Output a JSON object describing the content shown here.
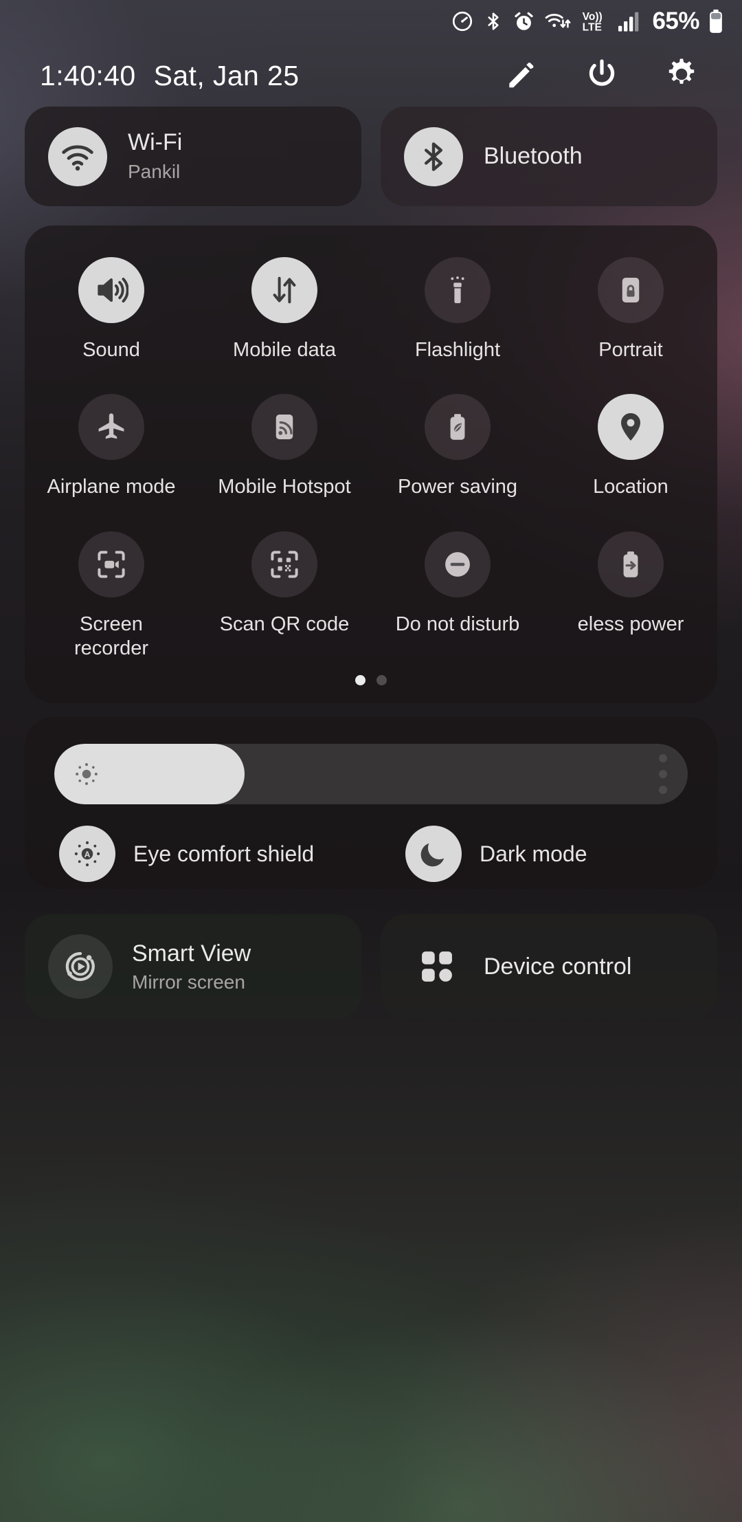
{
  "statusbar": {
    "icons": [
      {
        "name": "data-saver-icon"
      },
      {
        "name": "bluetooth-icon"
      },
      {
        "name": "alarm-icon"
      },
      {
        "name": "wifi-data-transfer-icon"
      },
      {
        "name": "volte-icon",
        "label_top": "Vo))",
        "label_bottom": "LTE"
      },
      {
        "name": "cellular-signal-icon"
      }
    ],
    "battery_percent": "65%",
    "battery_level": 65
  },
  "header": {
    "time": "1:40:40",
    "date": "Sat, Jan 25",
    "actions": [
      {
        "name": "edit-button",
        "icon": "pencil-icon"
      },
      {
        "name": "power-button",
        "icon": "power-icon"
      },
      {
        "name": "settings-button",
        "icon": "gear-icon"
      }
    ]
  },
  "top_tiles": [
    {
      "name": "wifi-tile",
      "icon": "wifi-icon",
      "title": "Wi-Fi",
      "subtitle": "Pankil",
      "active": true
    },
    {
      "name": "bluetooth-tile",
      "icon": "bluetooth-icon",
      "title": "Bluetooth",
      "subtitle": "",
      "active": true
    }
  ],
  "quick_settings": {
    "rows": [
      [
        {
          "name": "tile-sound",
          "icon": "sound-icon",
          "label": "Sound",
          "active": true
        },
        {
          "name": "tile-mobile-data",
          "icon": "mobile-data-icon",
          "label": "Mobile data",
          "active": true
        },
        {
          "name": "tile-flashlight",
          "icon": "flashlight-icon",
          "label": "Flashlight",
          "active": false
        },
        {
          "name": "tile-portrait",
          "icon": "rotation-lock-icon",
          "label": "Portrait",
          "active": false
        }
      ],
      [
        {
          "name": "tile-airplane-mode",
          "icon": "airplane-icon",
          "label": "Airplane mode",
          "active": false
        },
        {
          "name": "tile-mobile-hotspot",
          "icon": "hotspot-icon",
          "label": "Mobile Hotspot",
          "active": false
        },
        {
          "name": "tile-power-saving",
          "icon": "power-saving-icon",
          "label": "Power saving",
          "active": false
        },
        {
          "name": "tile-location",
          "icon": "location-pin-icon",
          "label": "Location",
          "active": true
        }
      ],
      [
        {
          "name": "tile-screen-recorder",
          "icon": "screen-recorder-icon",
          "label": "Screen recorder",
          "active": false
        },
        {
          "name": "tile-scan-qr-code",
          "icon": "qr-scan-icon",
          "label": "Scan QR code",
          "active": false
        },
        {
          "name": "tile-do-not-disturb",
          "icon": "do-not-disturb-icon",
          "label": "Do not disturb",
          "active": false
        },
        {
          "name": "tile-wireless-power-sharing",
          "icon": "wireless-power-share-icon",
          "label": "eless power",
          "active": false
        }
      ]
    ],
    "pager": {
      "total": 2,
      "current": 1
    }
  },
  "brightness": {
    "name": "brightness-slider",
    "icon": "brightness-sun-icon",
    "value_percent": 30,
    "menu_icon": "more-options-icon",
    "toggles": [
      {
        "name": "eye-comfort-shield-toggle",
        "icon": "eye-comfort-icon",
        "label": "Eye comfort shield",
        "active": true
      },
      {
        "name": "dark-mode-toggle",
        "icon": "moon-icon",
        "label": "Dark mode",
        "active": true
      }
    ]
  },
  "bottom_tiles": [
    {
      "name": "smart-view-tile",
      "icon": "smart-view-icon",
      "title": "Smart View",
      "subtitle": "Mirror screen"
    },
    {
      "name": "device-control-tile",
      "icon": "grid-squares-icon",
      "title": "Device control",
      "subtitle": ""
    }
  ],
  "colors": {
    "accent_on": "#d9d9d9",
    "icon_on_fg": "#3c3c3c",
    "panel_bg": "#1a1618",
    "text_primary": "#eceaea",
    "text_secondary": "#a9a5a5"
  }
}
